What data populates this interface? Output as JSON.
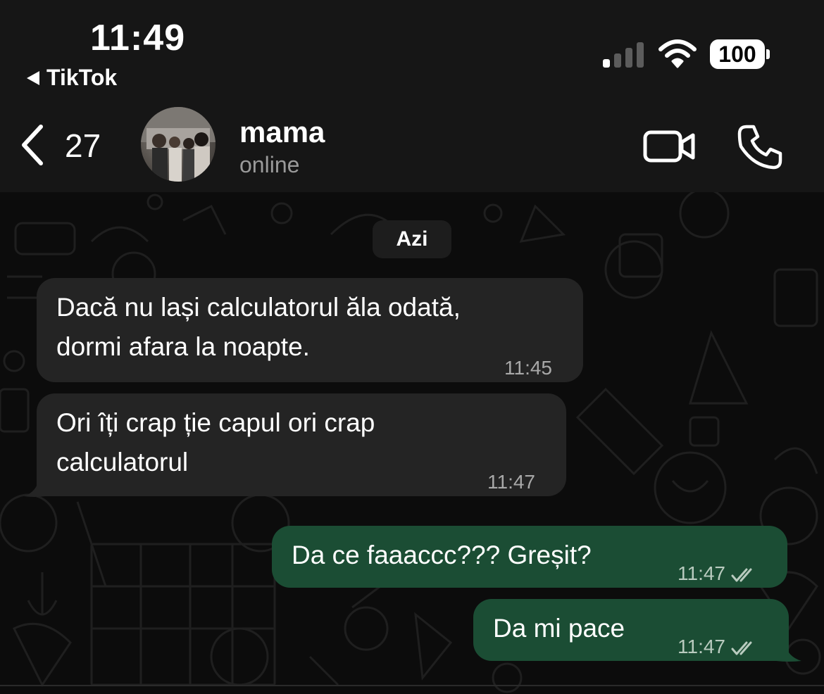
{
  "status_bar": {
    "time": "11:49",
    "back_app": "TikTok",
    "battery": "100"
  },
  "header": {
    "back_count": "27",
    "contact_name": "mama",
    "contact_status": "online"
  },
  "chat": {
    "date_label": "Azi",
    "messages": [
      {
        "direction": "incoming",
        "line1": "Dacă nu lași calculatorul ăla odată,",
        "line2": "dormi afara la noapte.",
        "time": "11:45"
      },
      {
        "direction": "incoming",
        "line1": "Ori îți crap ție capul ori crap",
        "line2": "calculatorul",
        "time": "11:47"
      },
      {
        "direction": "outgoing",
        "text": "Da ce faaaccc??? Greșit?",
        "time": "11:47",
        "status": "read"
      },
      {
        "direction": "outgoing",
        "text": "Da mi pace",
        "time": "11:47",
        "status": "read"
      }
    ]
  },
  "colors": {
    "incoming_bubble": "#242424",
    "outgoing_bubble": "#1b4d34",
    "background": "#0c0c0c",
    "header": "#161616"
  },
  "icons": [
    "back-triangle-icon",
    "signal-icon",
    "wifi-icon",
    "battery-icon",
    "chevron-left-icon",
    "video-call-icon",
    "phone-call-icon",
    "double-check-icon"
  ]
}
